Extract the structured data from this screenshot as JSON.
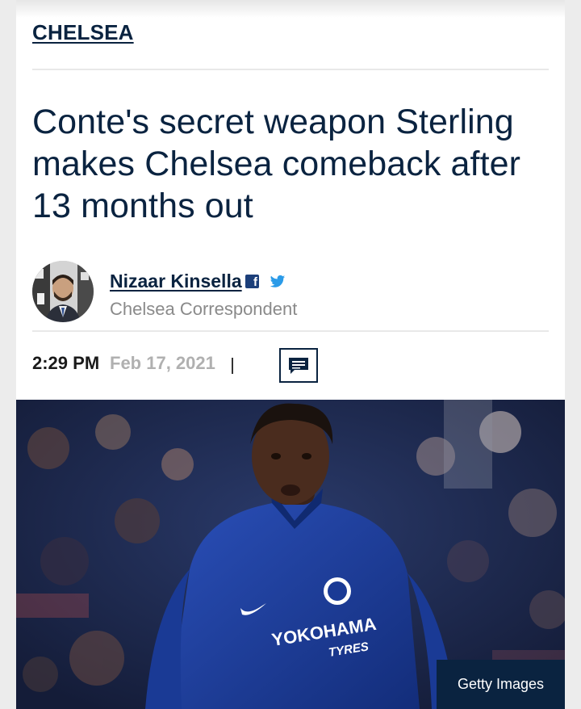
{
  "article": {
    "category": "CHELSEA",
    "headline": "Conte's secret weapon Sterling makes Chelsea comeback after 13 months out",
    "author": {
      "name": "Nizaar Kinsella",
      "role": "Chelsea Correspondent",
      "social_icons": [
        "facebook-icon",
        "twitter-icon"
      ]
    },
    "time": "2:29 PM",
    "date": "Feb 17, 2021",
    "comments_icon": "comment-icon",
    "image": {
      "credit": "Getty Images",
      "shirt_sponsor_line1": "YOKOHAMA",
      "shirt_sponsor_line2": "TYRES"
    }
  },
  "colors": {
    "brand_navy": "#0a2340",
    "muted_text": "#8a8a8a",
    "facebook_blue": "#1c3f7a",
    "twitter_blue": "#2b9be8",
    "kit_blue": "#1f3f9e"
  }
}
